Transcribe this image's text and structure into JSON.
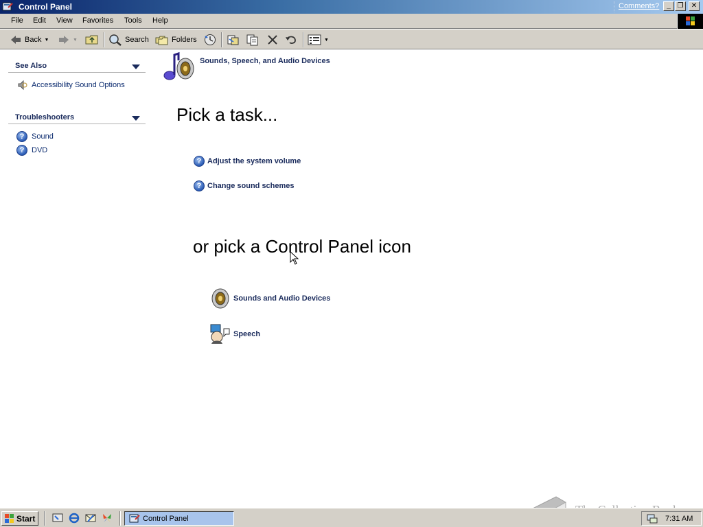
{
  "window": {
    "title": "Control Panel",
    "comments_link": "Comments?",
    "minimize_label": "_",
    "restore_label": "❐",
    "close_label": "✕"
  },
  "menu": [
    "File",
    "Edit",
    "View",
    "Favorites",
    "Tools",
    "Help"
  ],
  "toolbar": {
    "back_label": "Back",
    "search_label": "Search",
    "folders_label": "Folders"
  },
  "left_pane": {
    "see_also": {
      "title": "See Also",
      "items": [
        {
          "label": "Accessibility Sound Options",
          "icon": "speaker-icon"
        }
      ]
    },
    "troubleshooters": {
      "title": "Troubleshooters",
      "items": [
        {
          "label": "Sound",
          "icon": "help-icon"
        },
        {
          "label": "DVD",
          "icon": "help-icon"
        }
      ]
    }
  },
  "main": {
    "category_title": "Sounds, Speech, and Audio Devices",
    "task_heading": "Pick a task...",
    "tasks": [
      "Adjust the system volume",
      "Change sound schemes"
    ],
    "icon_heading": "or pick a Control Panel icon",
    "icons": [
      {
        "label": "Sounds and Audio Devices",
        "icon": "speaker-icon"
      },
      {
        "label": "Speech",
        "icon": "speech-icon"
      }
    ]
  },
  "taskbar": {
    "start_label": "Start",
    "task_button": "Control Panel",
    "clock": "7:31 AM"
  },
  "watermark": "The Collection Book",
  "colors": {
    "title_bar": "#0a246a",
    "link_blue": "#1a2b5c",
    "chrome": "#d4d0c8",
    "active_task": "#a8c4ec"
  }
}
